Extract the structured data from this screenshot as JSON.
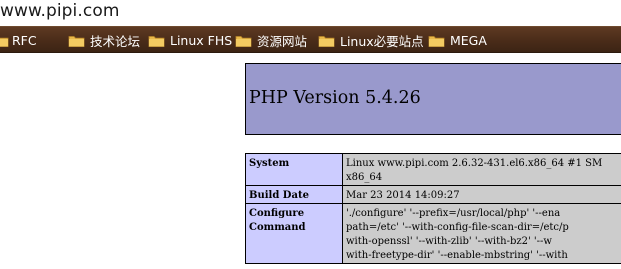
{
  "address_bar": {
    "url": "www.pipi.com"
  },
  "bookmarks_bar": {
    "items": [
      {
        "label": "RFC"
      },
      {
        "label": "技术论坛"
      },
      {
        "label": "Linux FHS"
      },
      {
        "label": "资源网站"
      },
      {
        "label": "Linux必要站点"
      },
      {
        "label": "MEGA"
      }
    ]
  },
  "phpinfo": {
    "title": "PHP Version 5.4.26",
    "rows": [
      {
        "key": "System",
        "lines": [
          "Linux www.pipi.com 2.6.32-431.el6.x86_64 #1 SM",
          "x86_64"
        ]
      },
      {
        "key": "Build Date",
        "lines": [
          "Mar 23 2014 14:09:27"
        ]
      },
      {
        "key": "Configure Command",
        "lines": [
          "'./configure' '--prefix=/usr/local/php' '--ena",
          "path=/etc' '--with-config-file-scan-dir=/etc/p",
          "with-openssl' '--with-zlib' '--with-bz2' '--w",
          "with-freetype-dir' '--enable-mbstring' '--with"
        ]
      }
    ]
  }
}
